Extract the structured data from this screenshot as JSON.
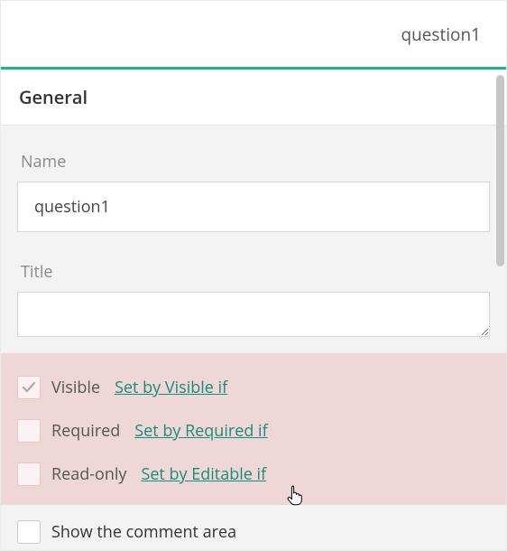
{
  "header": {
    "title": "question1"
  },
  "section": {
    "title": "General"
  },
  "fields": {
    "name": {
      "label": "Name",
      "value": "question1"
    },
    "title": {
      "label": "Title",
      "value": ""
    }
  },
  "options": {
    "visible": {
      "label": "Visible",
      "link": "Set by Visible if",
      "checked": true
    },
    "required": {
      "label": "Required",
      "link": "Set by Required if",
      "checked": false
    },
    "readonly": {
      "label": "Read-only",
      "link": "Set by Editable if",
      "checked": false
    },
    "comment": {
      "label": "Show the comment area",
      "checked": false
    }
  }
}
